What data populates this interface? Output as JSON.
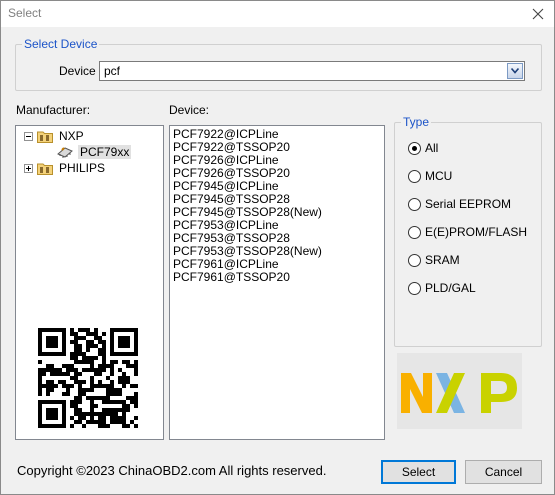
{
  "window": {
    "title": "Select"
  },
  "select_device": {
    "legend": "Select Device",
    "device_label": "Device",
    "device_value": "pcf"
  },
  "manufacturer": {
    "label": "Manufacturer:",
    "tree": [
      {
        "label": "NXP",
        "expanded": true,
        "icon": "folder-icon"
      },
      {
        "label": "PCF79xx",
        "selected": true,
        "icon": "chip-icon"
      },
      {
        "label": "PHILIPS",
        "expanded": false,
        "icon": "folder-icon"
      }
    ]
  },
  "device": {
    "label": "Device:",
    "items": [
      "PCF7922@ICPLine",
      "PCF7922@TSSOP20",
      "PCF7926@ICPLine",
      "PCF7926@TSSOP20",
      "PCF7945@ICPLine",
      "PCF7945@TSSOP28",
      "PCF7945@TSSOP28(New)",
      "PCF7953@ICPLine",
      "PCF7953@TSSOP28",
      "PCF7953@TSSOP28(New)",
      "PCF7961@ICPLine",
      "PCF7961@TSSOP20"
    ]
  },
  "type": {
    "legend": "Type",
    "options": [
      "All",
      "MCU",
      "Serial EEPROM",
      "E(E)PROM/FLASH",
      "SRAM",
      "PLD/GAL"
    ],
    "selected": "All"
  },
  "logo": {
    "text": "NXP",
    "colors": [
      "#f9b000",
      "#7bb4e3",
      "#c9d200"
    ]
  },
  "footer": {
    "copyright": "Copyright ©2023 ChinaOBD2.com All rights reserved.",
    "select_label": "Select",
    "cancel_label": "Cancel"
  }
}
